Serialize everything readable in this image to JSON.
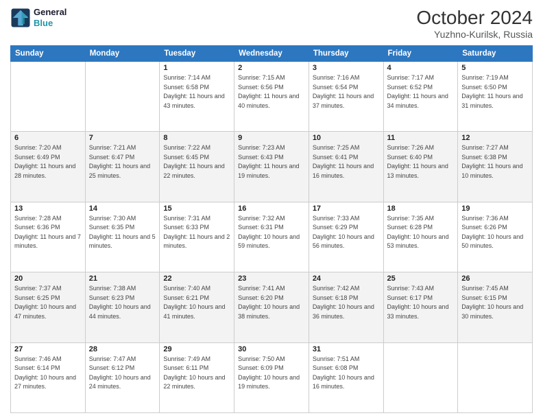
{
  "header": {
    "logo_line1": "General",
    "logo_line2": "Blue",
    "month": "October 2024",
    "location": "Yuzhno-Kurilsk, Russia"
  },
  "days_of_week": [
    "Sunday",
    "Monday",
    "Tuesday",
    "Wednesday",
    "Thursday",
    "Friday",
    "Saturday"
  ],
  "weeks": [
    [
      {
        "day": "",
        "sunrise": "",
        "sunset": "",
        "daylight": ""
      },
      {
        "day": "",
        "sunrise": "",
        "sunset": "",
        "daylight": ""
      },
      {
        "day": "1",
        "sunrise": "Sunrise: 7:14 AM",
        "sunset": "Sunset: 6:58 PM",
        "daylight": "Daylight: 11 hours and 43 minutes."
      },
      {
        "day": "2",
        "sunrise": "Sunrise: 7:15 AM",
        "sunset": "Sunset: 6:56 PM",
        "daylight": "Daylight: 11 hours and 40 minutes."
      },
      {
        "day": "3",
        "sunrise": "Sunrise: 7:16 AM",
        "sunset": "Sunset: 6:54 PM",
        "daylight": "Daylight: 11 hours and 37 minutes."
      },
      {
        "day": "4",
        "sunrise": "Sunrise: 7:17 AM",
        "sunset": "Sunset: 6:52 PM",
        "daylight": "Daylight: 11 hours and 34 minutes."
      },
      {
        "day": "5",
        "sunrise": "Sunrise: 7:19 AM",
        "sunset": "Sunset: 6:50 PM",
        "daylight": "Daylight: 11 hours and 31 minutes."
      }
    ],
    [
      {
        "day": "6",
        "sunrise": "Sunrise: 7:20 AM",
        "sunset": "Sunset: 6:49 PM",
        "daylight": "Daylight: 11 hours and 28 minutes."
      },
      {
        "day": "7",
        "sunrise": "Sunrise: 7:21 AM",
        "sunset": "Sunset: 6:47 PM",
        "daylight": "Daylight: 11 hours and 25 minutes."
      },
      {
        "day": "8",
        "sunrise": "Sunrise: 7:22 AM",
        "sunset": "Sunset: 6:45 PM",
        "daylight": "Daylight: 11 hours and 22 minutes."
      },
      {
        "day": "9",
        "sunrise": "Sunrise: 7:23 AM",
        "sunset": "Sunset: 6:43 PM",
        "daylight": "Daylight: 11 hours and 19 minutes."
      },
      {
        "day": "10",
        "sunrise": "Sunrise: 7:25 AM",
        "sunset": "Sunset: 6:41 PM",
        "daylight": "Daylight: 11 hours and 16 minutes."
      },
      {
        "day": "11",
        "sunrise": "Sunrise: 7:26 AM",
        "sunset": "Sunset: 6:40 PM",
        "daylight": "Daylight: 11 hours and 13 minutes."
      },
      {
        "day": "12",
        "sunrise": "Sunrise: 7:27 AM",
        "sunset": "Sunset: 6:38 PM",
        "daylight": "Daylight: 11 hours and 10 minutes."
      }
    ],
    [
      {
        "day": "13",
        "sunrise": "Sunrise: 7:28 AM",
        "sunset": "Sunset: 6:36 PM",
        "daylight": "Daylight: 11 hours and 7 minutes."
      },
      {
        "day": "14",
        "sunrise": "Sunrise: 7:30 AM",
        "sunset": "Sunset: 6:35 PM",
        "daylight": "Daylight: 11 hours and 5 minutes."
      },
      {
        "day": "15",
        "sunrise": "Sunrise: 7:31 AM",
        "sunset": "Sunset: 6:33 PM",
        "daylight": "Daylight: 11 hours and 2 minutes."
      },
      {
        "day": "16",
        "sunrise": "Sunrise: 7:32 AM",
        "sunset": "Sunset: 6:31 PM",
        "daylight": "Daylight: 10 hours and 59 minutes."
      },
      {
        "day": "17",
        "sunrise": "Sunrise: 7:33 AM",
        "sunset": "Sunset: 6:29 PM",
        "daylight": "Daylight: 10 hours and 56 minutes."
      },
      {
        "day": "18",
        "sunrise": "Sunrise: 7:35 AM",
        "sunset": "Sunset: 6:28 PM",
        "daylight": "Daylight: 10 hours and 53 minutes."
      },
      {
        "day": "19",
        "sunrise": "Sunrise: 7:36 AM",
        "sunset": "Sunset: 6:26 PM",
        "daylight": "Daylight: 10 hours and 50 minutes."
      }
    ],
    [
      {
        "day": "20",
        "sunrise": "Sunrise: 7:37 AM",
        "sunset": "Sunset: 6:25 PM",
        "daylight": "Daylight: 10 hours and 47 minutes."
      },
      {
        "day": "21",
        "sunrise": "Sunrise: 7:38 AM",
        "sunset": "Sunset: 6:23 PM",
        "daylight": "Daylight: 10 hours and 44 minutes."
      },
      {
        "day": "22",
        "sunrise": "Sunrise: 7:40 AM",
        "sunset": "Sunset: 6:21 PM",
        "daylight": "Daylight: 10 hours and 41 minutes."
      },
      {
        "day": "23",
        "sunrise": "Sunrise: 7:41 AM",
        "sunset": "Sunset: 6:20 PM",
        "daylight": "Daylight: 10 hours and 38 minutes."
      },
      {
        "day": "24",
        "sunrise": "Sunrise: 7:42 AM",
        "sunset": "Sunset: 6:18 PM",
        "daylight": "Daylight: 10 hours and 36 minutes."
      },
      {
        "day": "25",
        "sunrise": "Sunrise: 7:43 AM",
        "sunset": "Sunset: 6:17 PM",
        "daylight": "Daylight: 10 hours and 33 minutes."
      },
      {
        "day": "26",
        "sunrise": "Sunrise: 7:45 AM",
        "sunset": "Sunset: 6:15 PM",
        "daylight": "Daylight: 10 hours and 30 minutes."
      }
    ],
    [
      {
        "day": "27",
        "sunrise": "Sunrise: 7:46 AM",
        "sunset": "Sunset: 6:14 PM",
        "daylight": "Daylight: 10 hours and 27 minutes."
      },
      {
        "day": "28",
        "sunrise": "Sunrise: 7:47 AM",
        "sunset": "Sunset: 6:12 PM",
        "daylight": "Daylight: 10 hours and 24 minutes."
      },
      {
        "day": "29",
        "sunrise": "Sunrise: 7:49 AM",
        "sunset": "Sunset: 6:11 PM",
        "daylight": "Daylight: 10 hours and 22 minutes."
      },
      {
        "day": "30",
        "sunrise": "Sunrise: 7:50 AM",
        "sunset": "Sunset: 6:09 PM",
        "daylight": "Daylight: 10 hours and 19 minutes."
      },
      {
        "day": "31",
        "sunrise": "Sunrise: 7:51 AM",
        "sunset": "Sunset: 6:08 PM",
        "daylight": "Daylight: 10 hours and 16 minutes."
      },
      {
        "day": "",
        "sunrise": "",
        "sunset": "",
        "daylight": ""
      },
      {
        "day": "",
        "sunrise": "",
        "sunset": "",
        "daylight": ""
      }
    ]
  ]
}
